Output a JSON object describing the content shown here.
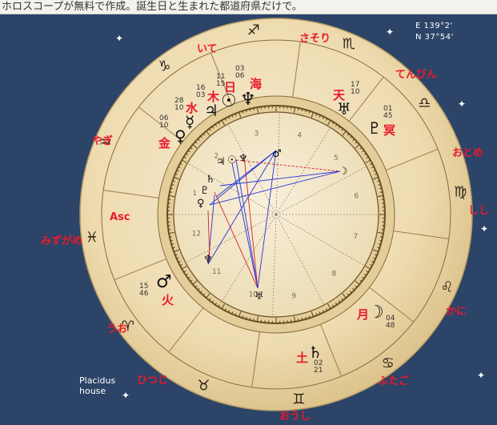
{
  "banner": {
    "text": "ホロスコープが無料で作成。誕生日と生まれた都道府県だけで。"
  },
  "coords": {
    "lon": "E 139°2'",
    "lat": "N 37°54'"
  },
  "house_system": {
    "line1": "Placidus",
    "line2": "house"
  },
  "signs": [
    {
      "name": "さそり",
      "glyph": "♏"
    },
    {
      "name": "てんびん",
      "glyph": "♎"
    },
    {
      "name": "おとめ",
      "glyph": "♍"
    },
    {
      "name": "しし",
      "glyph": "♌"
    },
    {
      "name": "かに",
      "glyph": "♋"
    },
    {
      "name": "ふたご",
      "glyph": "♊"
    },
    {
      "name": "おうし",
      "glyph": "♉"
    },
    {
      "name": "ひつじ",
      "glyph": "♈"
    },
    {
      "name": "うお",
      "glyph": "♓"
    },
    {
      "name": "みずがめ",
      "glyph": "♒"
    },
    {
      "name": "やぎ",
      "glyph": "♑"
    },
    {
      "name": "いて",
      "glyph": "♐"
    }
  ],
  "asc_label": "Asc",
  "planets": [
    {
      "name": "日",
      "glyph": "☉",
      "deg": "11",
      "min": "15"
    },
    {
      "name": "海",
      "glyph": "♆",
      "deg": "03",
      "min": "06"
    },
    {
      "name": "木",
      "glyph": "♃",
      "deg": "16",
      "min": "03"
    },
    {
      "name": "水",
      "glyph": "☿",
      "deg": "28",
      "min": "10"
    },
    {
      "name": "金",
      "glyph": "♀",
      "deg": "06",
      "min": "10"
    },
    {
      "name": "天",
      "glyph": "♅",
      "deg": "17",
      "min": "10"
    },
    {
      "name": "冥",
      "glyph": "♇",
      "deg": "01",
      "min": "45"
    },
    {
      "name": "火",
      "glyph": "♂",
      "deg": "15",
      "min": "46"
    },
    {
      "name": "月",
      "glyph": "☽",
      "deg": "04",
      "min": "48"
    },
    {
      "name": "土",
      "glyph": "♄",
      "deg": "02",
      "min": "21"
    }
  ],
  "colors": {
    "background": "#2b4468",
    "parchment": "#f0dfb6",
    "ring": "#e6cf9a",
    "label": "#e8192c",
    "glyph": "#111111",
    "aspect_blue": "#2034d8",
    "aspect_red": "#d62020"
  }
}
